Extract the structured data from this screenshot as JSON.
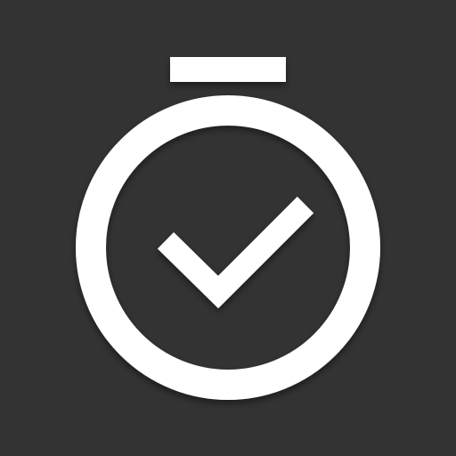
{
  "icon": {
    "name": "stopwatch-check-icon",
    "background_color": "#333333",
    "foreground_color": "#ffffff"
  }
}
